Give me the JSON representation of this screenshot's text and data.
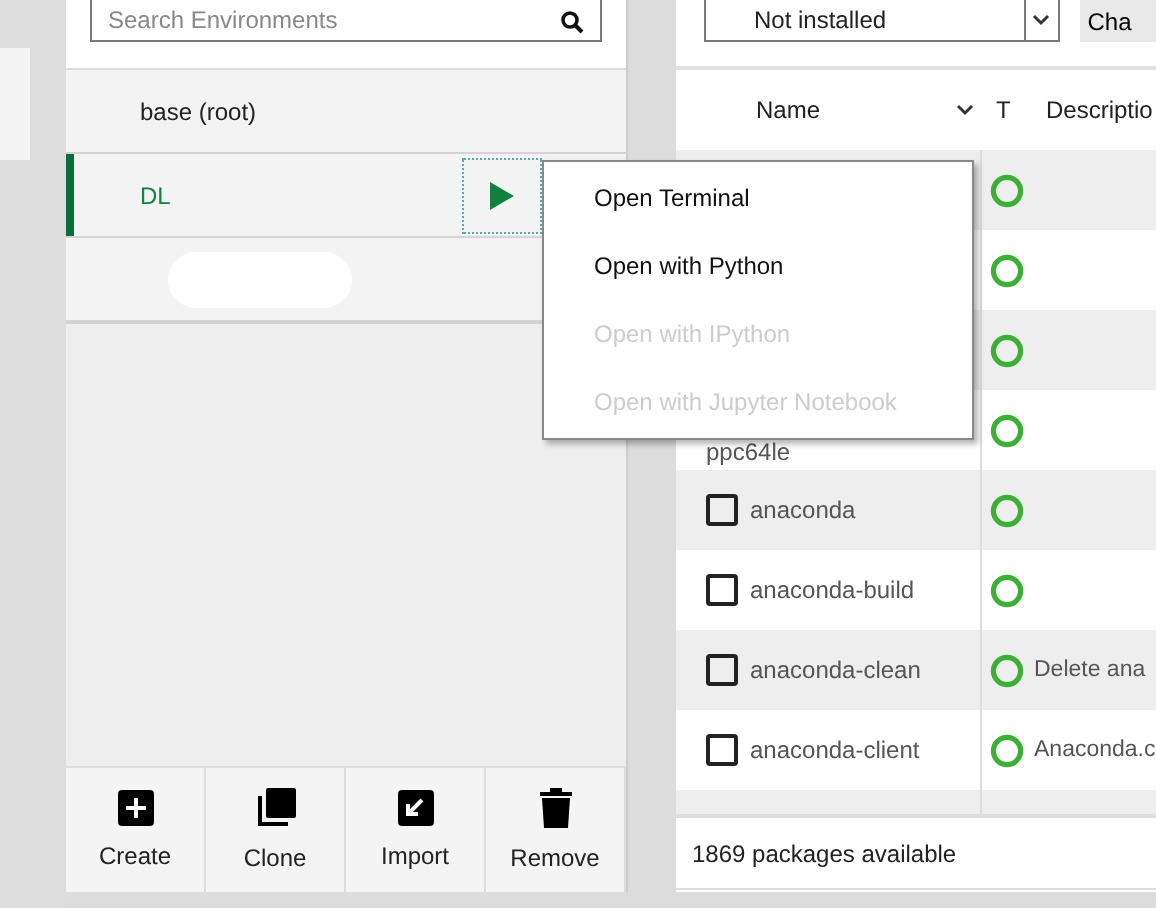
{
  "search": {
    "placeholder": "Search Environments"
  },
  "environments": [
    {
      "kind": "env",
      "name": "base (root)",
      "selected": false,
      "play_button": false
    },
    {
      "kind": "env",
      "name": "DL",
      "selected": true,
      "play_button": true
    },
    {
      "kind": "redacted",
      "selected": false
    }
  ],
  "env_actions": [
    {
      "label": "Create"
    },
    {
      "label": "Clone"
    },
    {
      "label": "Import"
    },
    {
      "label": "Remove"
    }
  ],
  "context_menu": [
    {
      "label": "Open Terminal",
      "disabled": false
    },
    {
      "label": "Open with Python",
      "disabled": false
    },
    {
      "label": "Open with IPython",
      "disabled": true
    },
    {
      "label": "Open with Jupyter Notebook",
      "disabled": true
    }
  ],
  "filter": {
    "value": "Not installed"
  },
  "channels_button": "Cha",
  "packages": {
    "columns": [
      "Name",
      "T",
      "Descriptio"
    ],
    "rows": [
      {},
      {},
      {},
      {
        "name": "ppc64le"
      },
      {
        "name": "anaconda",
        "checked": false
      },
      {
        "name": "anaconda-build",
        "checked": false
      },
      {
        "name": "anaconda-clean",
        "checked": false,
        "description": "Delete ana"
      },
      {
        "name": "anaconda-client",
        "checked": false,
        "description": "Anaconda.c"
      }
    ]
  },
  "footer": "1869 packages available"
}
